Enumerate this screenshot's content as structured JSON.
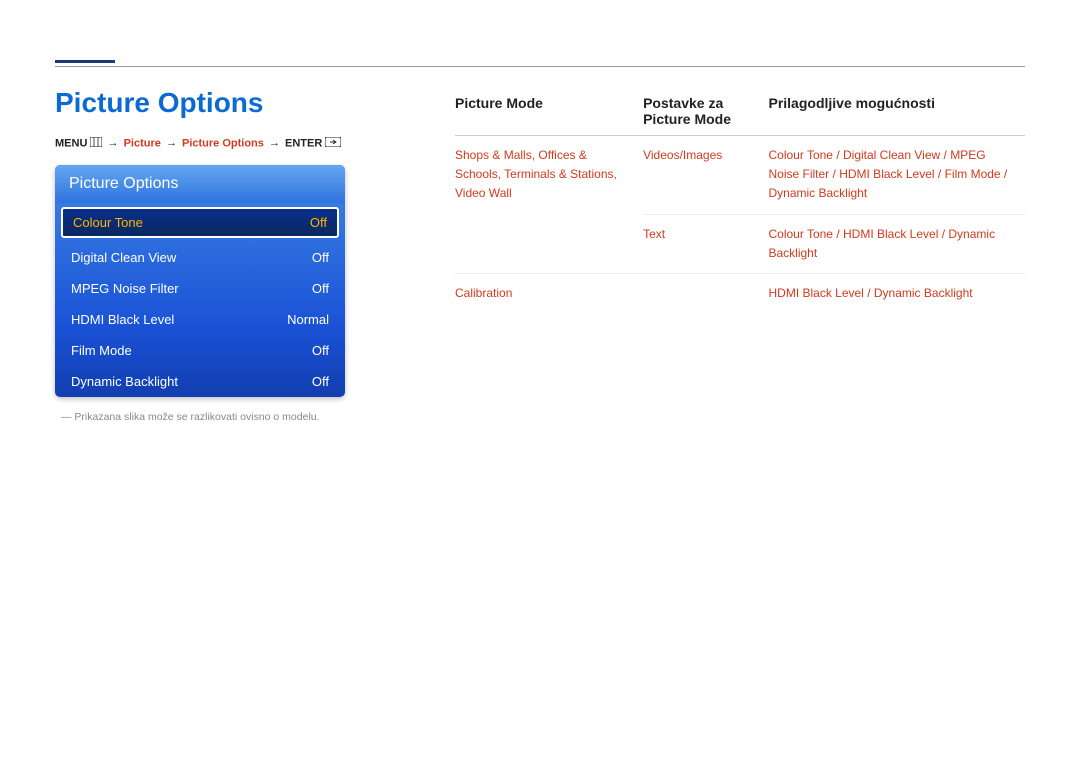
{
  "rule": {},
  "page_title": "Picture Options",
  "breadcrumb": {
    "menu_label": "MENU",
    "arrow": "→",
    "picture": "Picture",
    "picture_options": "Picture Options",
    "enter_label": "ENTER"
  },
  "menu_panel": {
    "header": "Picture Options",
    "rows": [
      {
        "label": "Colour Tone",
        "value": "Off",
        "selected": true
      },
      {
        "label": "Digital Clean View",
        "value": "Off",
        "selected": false
      },
      {
        "label": "MPEG Noise Filter",
        "value": "Off",
        "selected": false
      },
      {
        "label": "HDMI Black Level",
        "value": "Normal",
        "selected": false
      },
      {
        "label": "Film Mode",
        "value": "Off",
        "selected": false
      },
      {
        "label": "Dynamic Backlight",
        "value": "Off",
        "selected": false
      }
    ]
  },
  "footnote": "Prikazana slika može se razlikovati ovisno o modelu.",
  "table": {
    "headers": {
      "picture_mode": "Picture Mode",
      "postavke": "Postavke za Picture Mode",
      "prilag": "Prilagodljive mogućnosti"
    },
    "rows": {
      "r0": {
        "pm_parts": [
          "Shops & Malls",
          "Offices & Schools",
          "Terminals & Stations",
          "Video Wall"
        ],
        "postavke": "Videos/Images",
        "opt_parts": [
          "Colour Tone",
          "Digital Clean View",
          "MPEG Noise Filter",
          "HDMI Black Level",
          "Film Mode",
          "Dynamic Backlight"
        ]
      },
      "r1": {
        "pm_parts": [],
        "postavke": "Text",
        "opt_parts": [
          "Colour Tone",
          "HDMI Black Level",
          "Dynamic Backlight"
        ]
      },
      "r2": {
        "pm_parts": [
          "Calibration"
        ],
        "postavke": "",
        "opt_parts": [
          "HDMI Black Level",
          "Dynamic Backlight"
        ]
      }
    }
  }
}
